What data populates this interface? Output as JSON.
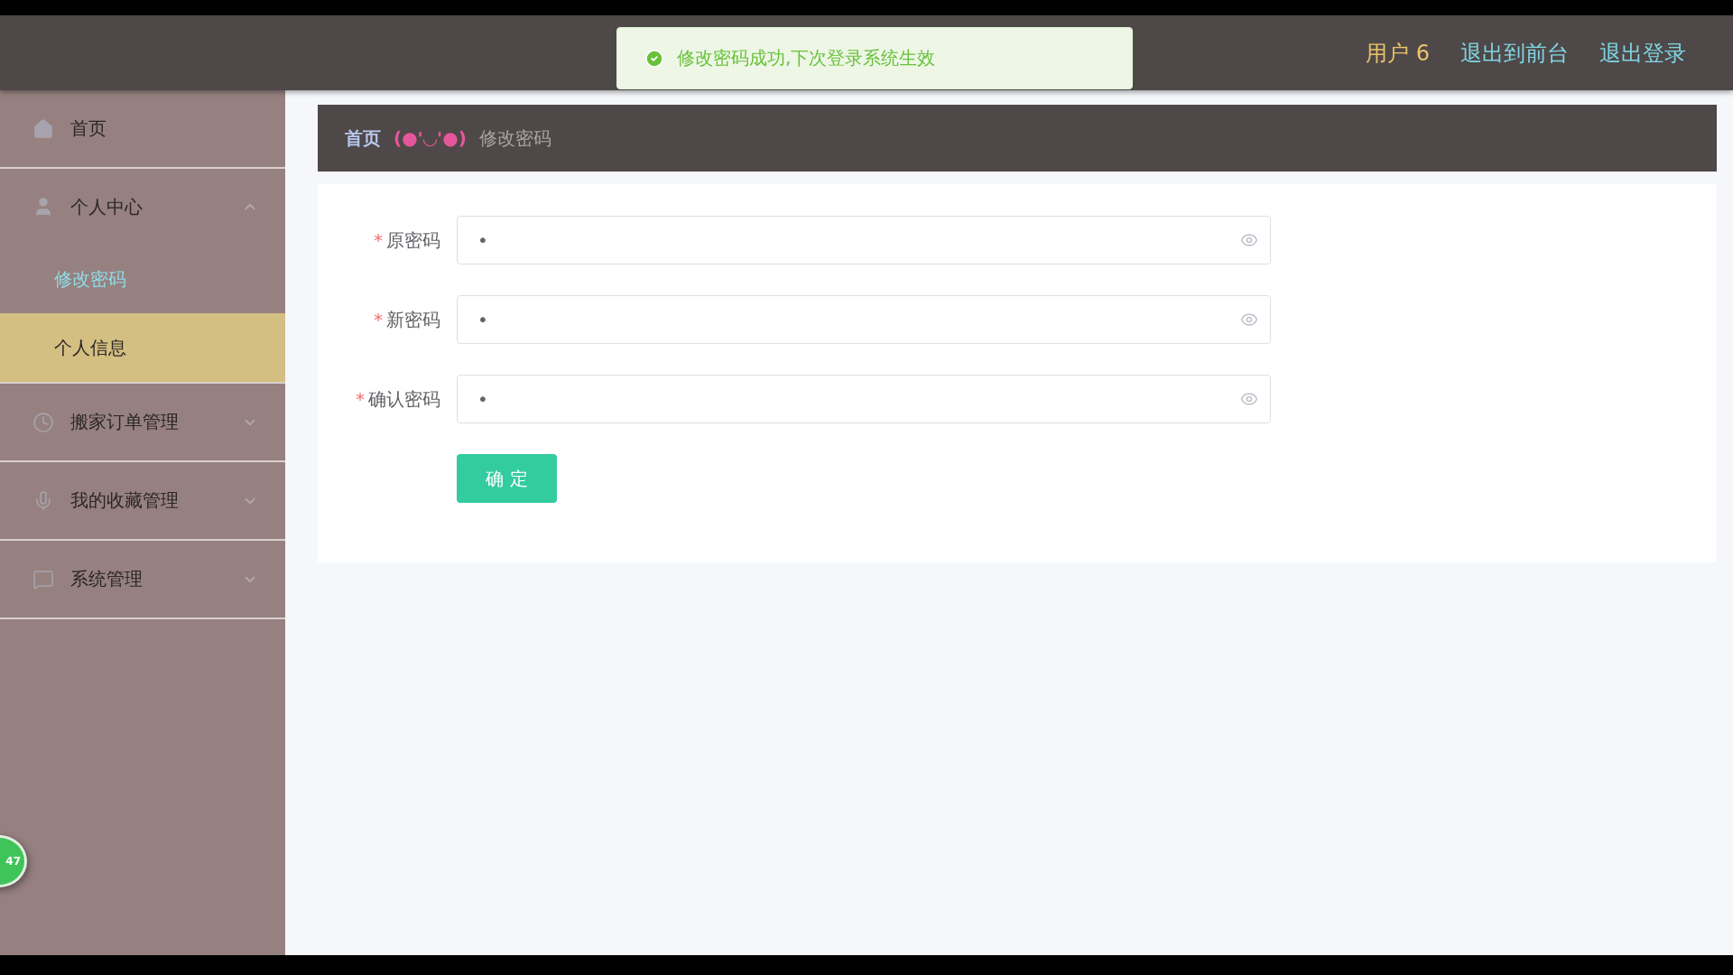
{
  "toast": {
    "kind": "success",
    "message": "修改密码成功,下次登录系统生效"
  },
  "header": {
    "user": "用户 6",
    "links": [
      "退出到前台",
      "退出登录"
    ]
  },
  "sidebar": {
    "items": [
      {
        "label": "首页",
        "kind": "link"
      },
      {
        "label": "个人中心",
        "kind": "submenu",
        "expanded": true,
        "children": [
          {
            "label": "修改密码",
            "selected": true,
            "hovered": false
          },
          {
            "label": "个人信息",
            "selected": false,
            "hovered": true
          }
        ]
      },
      {
        "label": "搬家订单管理",
        "kind": "submenu",
        "expanded": false
      },
      {
        "label": "我的收藏管理",
        "kind": "submenu",
        "expanded": false
      },
      {
        "label": "系统管理",
        "kind": "submenu",
        "expanded": false
      }
    ]
  },
  "breadcrumb": {
    "home": "首页",
    "face": "(●'◡'●)",
    "current": "修改密码"
  },
  "form": {
    "fields": [
      {
        "label": "原密码",
        "required_mark": "*",
        "value": "•"
      },
      {
        "label": "新密码",
        "required_mark": "*",
        "value": "•"
      },
      {
        "label": "确认密码",
        "required_mark": "*",
        "value": "•"
      }
    ],
    "submit": "确 定"
  },
  "badge": "47"
}
